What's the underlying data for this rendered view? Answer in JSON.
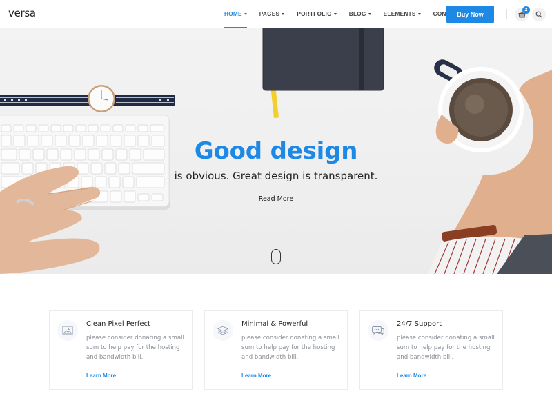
{
  "header": {
    "logo": "versa",
    "nav": [
      {
        "label": "HOME",
        "active": true
      },
      {
        "label": "PAGES",
        "active": false
      },
      {
        "label": "PORTFOLIO",
        "active": false
      },
      {
        "label": "BLOG",
        "active": false
      },
      {
        "label": "ELEMENTS",
        "active": false
      },
      {
        "label": "CONTACT",
        "active": false
      }
    ],
    "buy_button": "Buy Now",
    "cart_count": "2",
    "icons": {
      "cart": "shopping-basket-icon",
      "search": "search-icon"
    },
    "accent": "#1e88e5"
  },
  "hero": {
    "title": "Good design",
    "subtitle": "is obvious. Great design is transparent.",
    "link": "Read More",
    "scroll_icon": "mouse-scroll-icon"
  },
  "features": [
    {
      "icon": "image-icon",
      "title": "Clean Pixel Perfect",
      "text": "please consider donating a small sum to help pay for the hosting and bandwidth bill.",
      "link": "Learn More"
    },
    {
      "icon": "layers-icon",
      "title": "Minimal & Powerful",
      "text": "please consider donating a small sum to help pay for the hosting and bandwidth bill.",
      "link": "Learn More"
    },
    {
      "icon": "chat-bubbles-icon",
      "title": "24/7 Support",
      "text": "please consider donating a small sum to help pay for the hosting and bandwidth bill.",
      "link": "Learn More"
    }
  ]
}
